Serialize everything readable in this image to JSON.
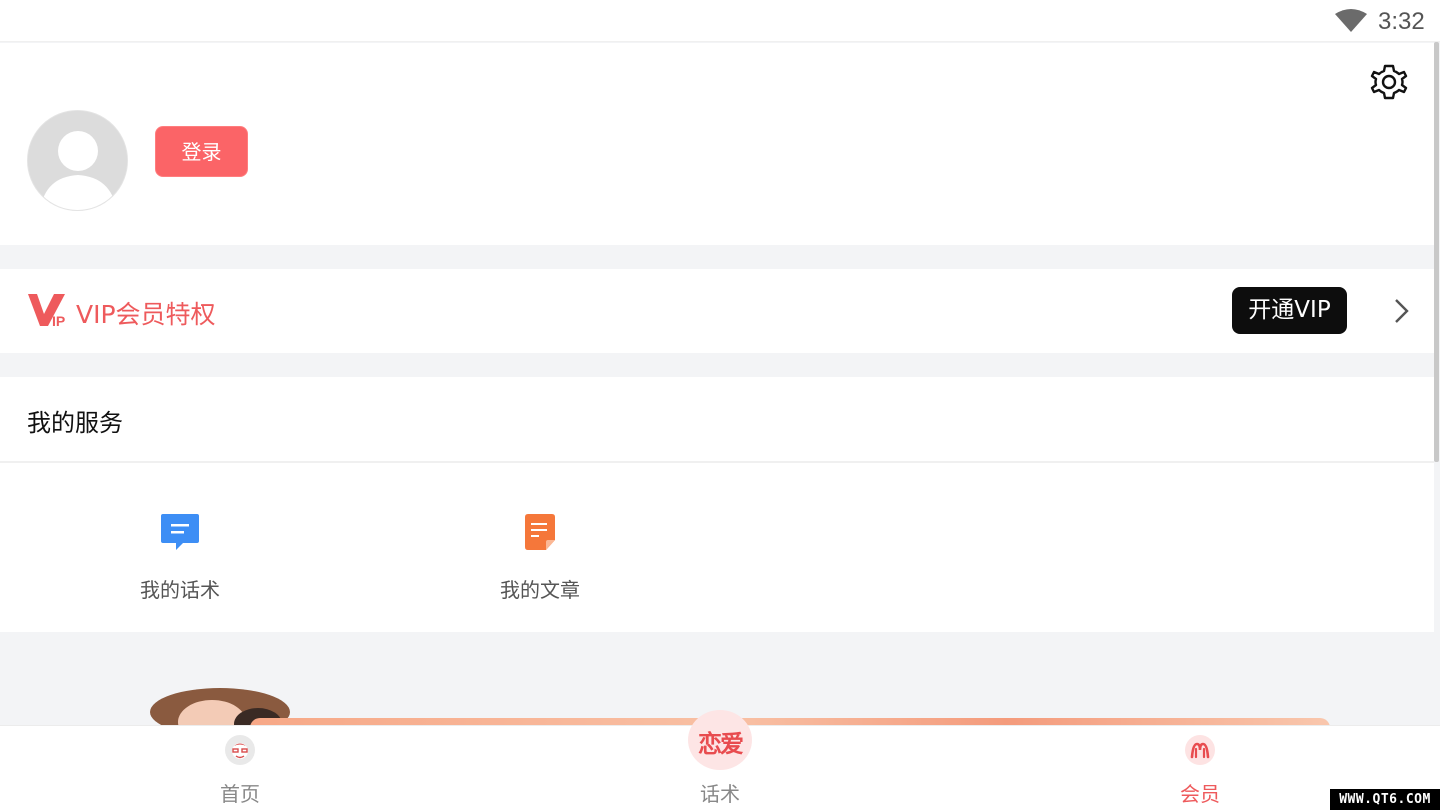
{
  "status_bar": {
    "time": "3:32",
    "wifi_icon": "wifi-icon"
  },
  "profile": {
    "login_label": "登录",
    "avatar_icon": "default-avatar-icon",
    "settings_icon": "gear-icon"
  },
  "vip": {
    "logo_icon": "vip-logo-icon",
    "title": "VIP会员特权",
    "button_label": "开通VIP",
    "chevron_icon": "chevron-right-icon"
  },
  "services": {
    "title": "我的服务",
    "items": [
      {
        "label": "我的话术",
        "icon": "chat-bubble-icon",
        "color": "#3d8ef5"
      },
      {
        "label": "我的文章",
        "icon": "document-icon",
        "color": "#f5773a"
      }
    ]
  },
  "tabbar": {
    "items": [
      {
        "label": "首页",
        "icon": "home-face-icon",
        "active": false
      },
      {
        "label": "话术",
        "icon": "love-logo-icon",
        "badge_text": "恋爱",
        "active": false
      },
      {
        "label": "会员",
        "icon": "member-icon",
        "active": true
      }
    ]
  },
  "watermark": "WWW.QT6.COM",
  "colors": {
    "accent": "#fb6467",
    "vip_text": "#ee5a5c",
    "vip_button": "#0d0d0d",
    "page_bg": "#f3f4f6"
  }
}
